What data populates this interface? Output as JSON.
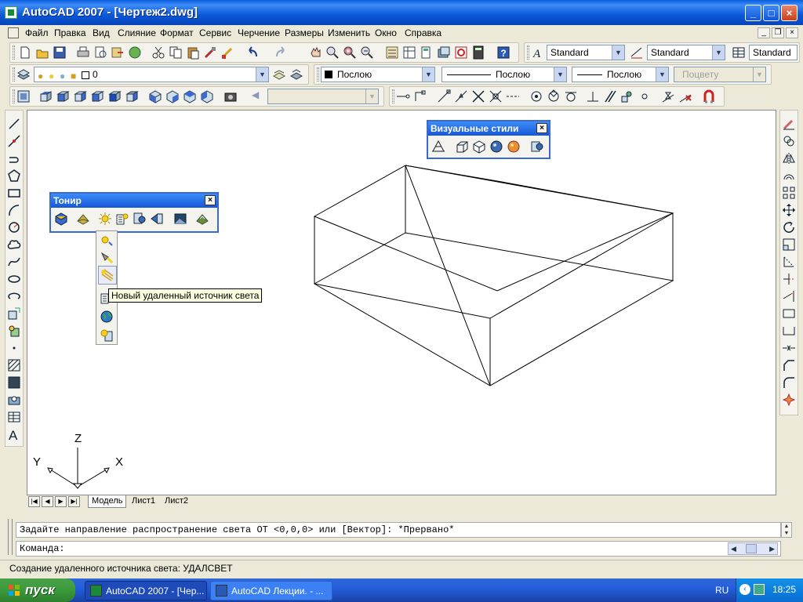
{
  "window": {
    "title": "AutoCAD 2007 - [Чертеж2.dwg]",
    "minimize": "_",
    "maximize": "□",
    "close": "×"
  },
  "menu": {
    "items": [
      "Файл",
      "Правка",
      "Вид",
      "Слияние",
      "Формат",
      "Сервис",
      "Черчение",
      "Размеры",
      "Изменить",
      "Окно",
      "Справка"
    ]
  },
  "toolbar1": {
    "text_style": "Standard",
    "dim_style": "Standard",
    "table_style": "Standard"
  },
  "toolbar2": {
    "layer": "0",
    "color": "Послою",
    "linetype": "Послою",
    "lineweight": "Послою",
    "plotstyle": "Поцвету"
  },
  "float_toner": {
    "title": "Тонир",
    "close": "×"
  },
  "float_visual": {
    "title": "Визуальные стили",
    "close": "×"
  },
  "tooltip": "Новый удаленный источник света",
  "ucs": {
    "x": "X",
    "y": "Y",
    "z": "Z"
  },
  "tabs": {
    "model": "Модель",
    "sheet1": "Лист1",
    "sheet2": "Лист2"
  },
  "command": {
    "history": "Задайте направление распространение света ОТ <0,0,0> или [Вектор]: *Прервано*",
    "prompt": "Команда:"
  },
  "status": "Создание удаленного источника света: УДАЛСВЕТ",
  "taskbar": {
    "start": "пуск",
    "items": [
      "AutoCAD 2007 - [Чер...",
      "AutoCAD Лекции. - ..."
    ],
    "lang": "RU",
    "clock": "18:25"
  },
  "colors": {
    "titlebar": "#0A58D8",
    "taskbar": "#245EDC",
    "start": "#3A9A3A",
    "tooltip_bg": "#FFFFE1"
  }
}
